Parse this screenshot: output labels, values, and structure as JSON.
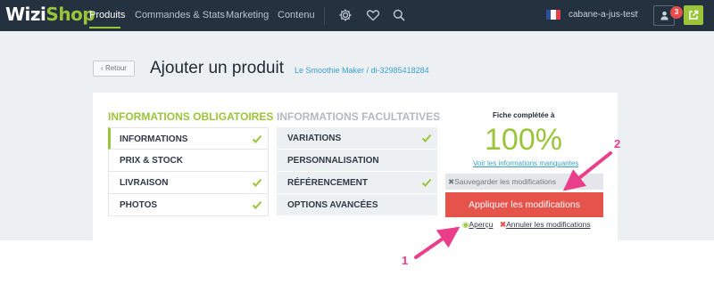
{
  "brand": {
    "part1": "Wizi",
    "part2": "Shop"
  },
  "nav": {
    "items": [
      "Produits",
      "Commandes & Stats",
      "Marketing",
      "Contenu"
    ],
    "shop_name": "cabane-a-jus-test",
    "notification_count": "3"
  },
  "header": {
    "back_label": "Retour",
    "title": "Ajouter un produit",
    "subtitle": "Le Smoothie Maker / di-32985418284"
  },
  "sections": {
    "required_title": "INFORMATIONS OBLIGATOIRES",
    "optional_title": "INFORMATIONS FACULTATIVES",
    "required": [
      {
        "label": "INFORMATIONS",
        "complete": true,
        "active": true
      },
      {
        "label": "PRIX & STOCK",
        "complete": false
      },
      {
        "label": "LIVRAISON",
        "complete": true
      },
      {
        "label": "PHOTOS",
        "complete": true
      }
    ],
    "optional": [
      {
        "label": "VARIATIONS",
        "complete": true
      },
      {
        "label": "PERSONNALISATION",
        "complete": false
      },
      {
        "label": "RÉFÉRENCEMENT",
        "complete": true
      },
      {
        "label": "OPTIONS AVANCÉES",
        "complete": false
      }
    ]
  },
  "completion": {
    "label": "Fiche complétée à",
    "value": "100%",
    "missing_link": "Voir les informations manquantes"
  },
  "actions": {
    "save_label": "Sauvegarder les modifications",
    "apply_label": "Appliquer les modifications",
    "preview_label": "Aperçu",
    "cancel_label": "Annuler les modifications"
  },
  "annotations": {
    "one": "1",
    "two": "2"
  },
  "colors": {
    "accent": "#9ac43a",
    "danger": "#e5534b",
    "nav_bg": "#24313e",
    "annotation": "#ea3d8a",
    "link": "#3aa0c8"
  },
  "icons": [
    "settings-icon",
    "heart-icon",
    "search-icon",
    "user-icon",
    "external-link-icon",
    "check-icon",
    "eye-icon",
    "close-icon",
    "chevron-left-icon"
  ]
}
